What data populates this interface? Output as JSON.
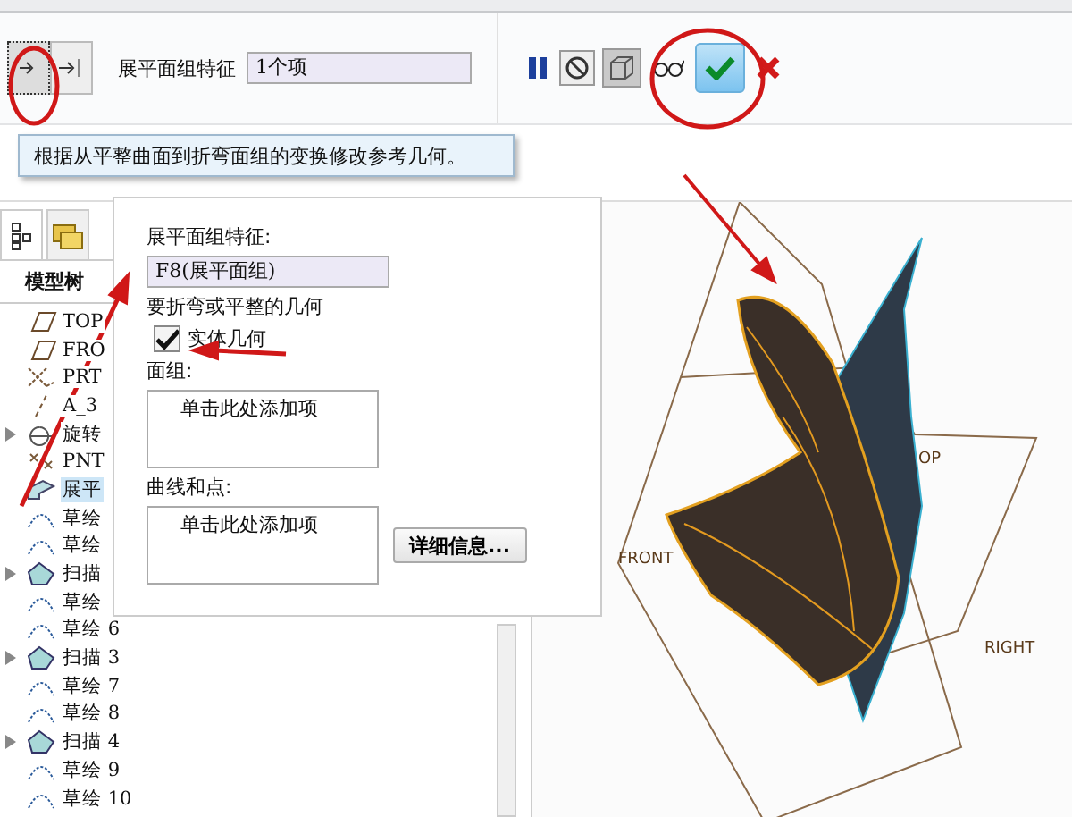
{
  "toolbar": {
    "nav_buttons": [
      {
        "kind": "step",
        "selected": true
      },
      {
        "kind": "end",
        "selected": false
      }
    ],
    "feature_label": "展平面组特征",
    "feature_value": "1个项",
    "actions": [
      {
        "kind": "pause"
      },
      {
        "kind": "stop"
      },
      {
        "kind": "preview"
      },
      {
        "kind": "glasses"
      },
      {
        "kind": "ok"
      },
      {
        "kind": "cancel"
      }
    ]
  },
  "tooltip": "根据从平整曲面到折弯面组的变换修改参考几何。",
  "tree": {
    "header": "模型树",
    "items": [
      {
        "label": "TOP",
        "kind": "plane",
        "expandable": false,
        "selected": false
      },
      {
        "label": "FRO",
        "kind": "plane",
        "expandable": false,
        "selected": false
      },
      {
        "label": "PRT",
        "kind": "csys",
        "expandable": false,
        "selected": false
      },
      {
        "label": "A_3",
        "kind": "axis",
        "expandable": false,
        "selected": false
      },
      {
        "label": "旋转",
        "kind": "revolve",
        "expandable": true,
        "selected": false
      },
      {
        "label": "PNT",
        "kind": "point",
        "expandable": false,
        "selected": false
      },
      {
        "label": "展平",
        "kind": "flatten",
        "expandable": false,
        "selected": true
      },
      {
        "label": "草绘",
        "kind": "sketch",
        "expandable": false,
        "selected": false
      },
      {
        "label": "草绘",
        "kind": "sketch",
        "expandable": false,
        "selected": false
      },
      {
        "label": "扫描",
        "kind": "sweep",
        "expandable": true,
        "selected": false
      },
      {
        "label": "草绘",
        "kind": "sketch",
        "expandable": false,
        "selected": false
      },
      {
        "label": "草绘 6",
        "kind": "sketch",
        "expandable": false,
        "selected": false
      },
      {
        "label": "扫描 3",
        "kind": "sweep",
        "expandable": true,
        "selected": false
      },
      {
        "label": "草绘 7",
        "kind": "sketch",
        "expandable": false,
        "selected": false
      },
      {
        "label": "草绘 8",
        "kind": "sketch",
        "expandable": false,
        "selected": false
      },
      {
        "label": "扫描 4",
        "kind": "sweep",
        "expandable": true,
        "selected": false
      },
      {
        "label": "草绘 9",
        "kind": "sketch",
        "expandable": false,
        "selected": false
      },
      {
        "label": "草绘 10",
        "kind": "sketch",
        "expandable": false,
        "selected": false
      }
    ]
  },
  "dialog": {
    "feature_label": "展平面组特征:",
    "feature_value": "F8(展平面组)",
    "geometry_label": "要折弯或平整的几何",
    "solid": {
      "label": "实体几何",
      "checked": true
    },
    "quilts_label": "面组:",
    "quilts_placeholder": "单击此处添加项",
    "curves_label": "曲线和点:",
    "curves_placeholder": "单击此处添加项",
    "details_button": "详细信息..."
  },
  "viewport": {
    "datum_labels": [
      {
        "text": "OP",
        "kind": "top"
      },
      {
        "text": "FRONT",
        "kind": "front"
      },
      {
        "text": "RIGHT",
        "kind": "right"
      }
    ]
  }
}
